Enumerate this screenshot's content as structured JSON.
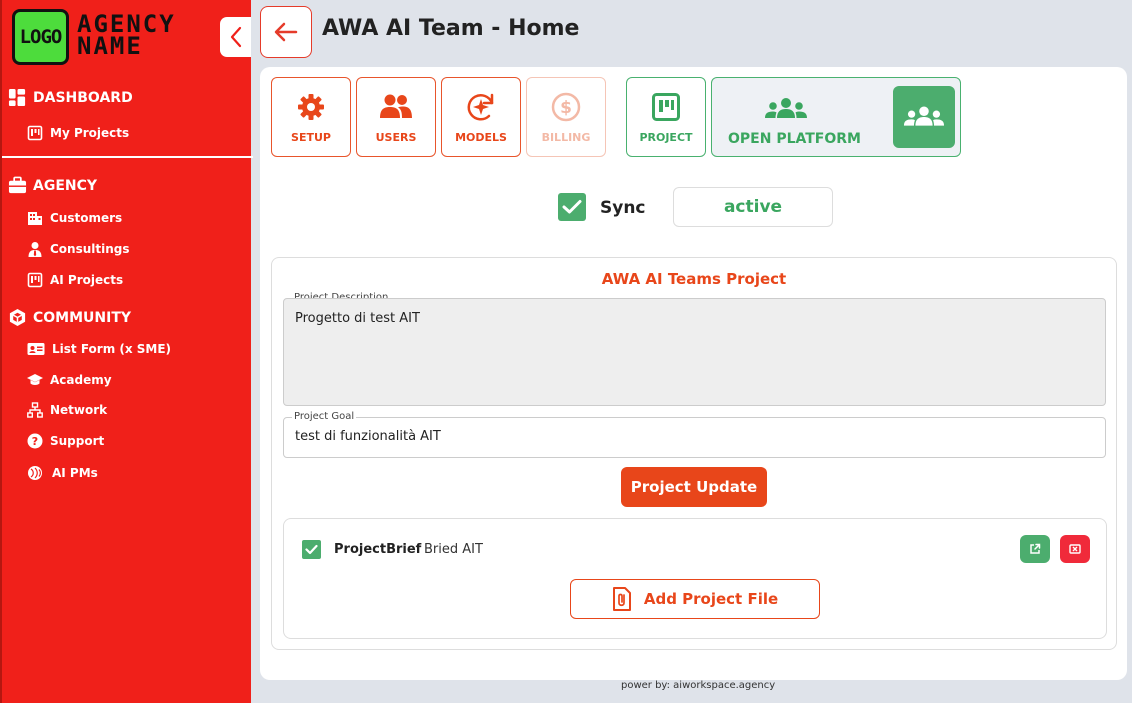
{
  "brand": {
    "logo_text": "LOGO",
    "agency_name": "AGENCY\nNAME"
  },
  "sidebar": {
    "dashboard": {
      "label": "DASHBOARD",
      "items": [
        {
          "label": "My Projects"
        }
      ]
    },
    "agency": {
      "label": "AGENCY",
      "items": [
        {
          "label": "Customers"
        },
        {
          "label": "Consultings"
        },
        {
          "label": "AI Projects"
        }
      ]
    },
    "community": {
      "label": "COMMUNITY",
      "items": [
        {
          "label": "List Form (x SME)"
        },
        {
          "label": "Academy"
        },
        {
          "label": "Network"
        },
        {
          "label": "Support"
        },
        {
          "label": "AI PMs"
        }
      ]
    }
  },
  "header": {
    "title": "AWA AI Team - Home"
  },
  "toolbar": {
    "setup": "SETUP",
    "users": "USERS",
    "models": "MODELS",
    "billing": "BILLING",
    "project": "PROJECT",
    "open_platform": "OPEN PLATFORM"
  },
  "sync": {
    "label": "Sync",
    "checked": true,
    "status": "active"
  },
  "project": {
    "title": "AWA AI Teams Project",
    "description_label": "Project Description",
    "description": "Progetto di test AIT",
    "goal_label": "Project Goal",
    "goal": "test di funzionalità AIT",
    "update_button": "Project Update"
  },
  "files": {
    "items": [
      {
        "name": "ProjectBrief",
        "description": "Bried AIT",
        "checked": true
      }
    ],
    "add_button": "Add Project File"
  },
  "footer": {
    "text": "power by: aiworkspace.agency"
  },
  "colors": {
    "sidebar": "#f0201a",
    "accent": "#e8461a",
    "green": "#4cad6e",
    "danger": "#f02a3a"
  }
}
